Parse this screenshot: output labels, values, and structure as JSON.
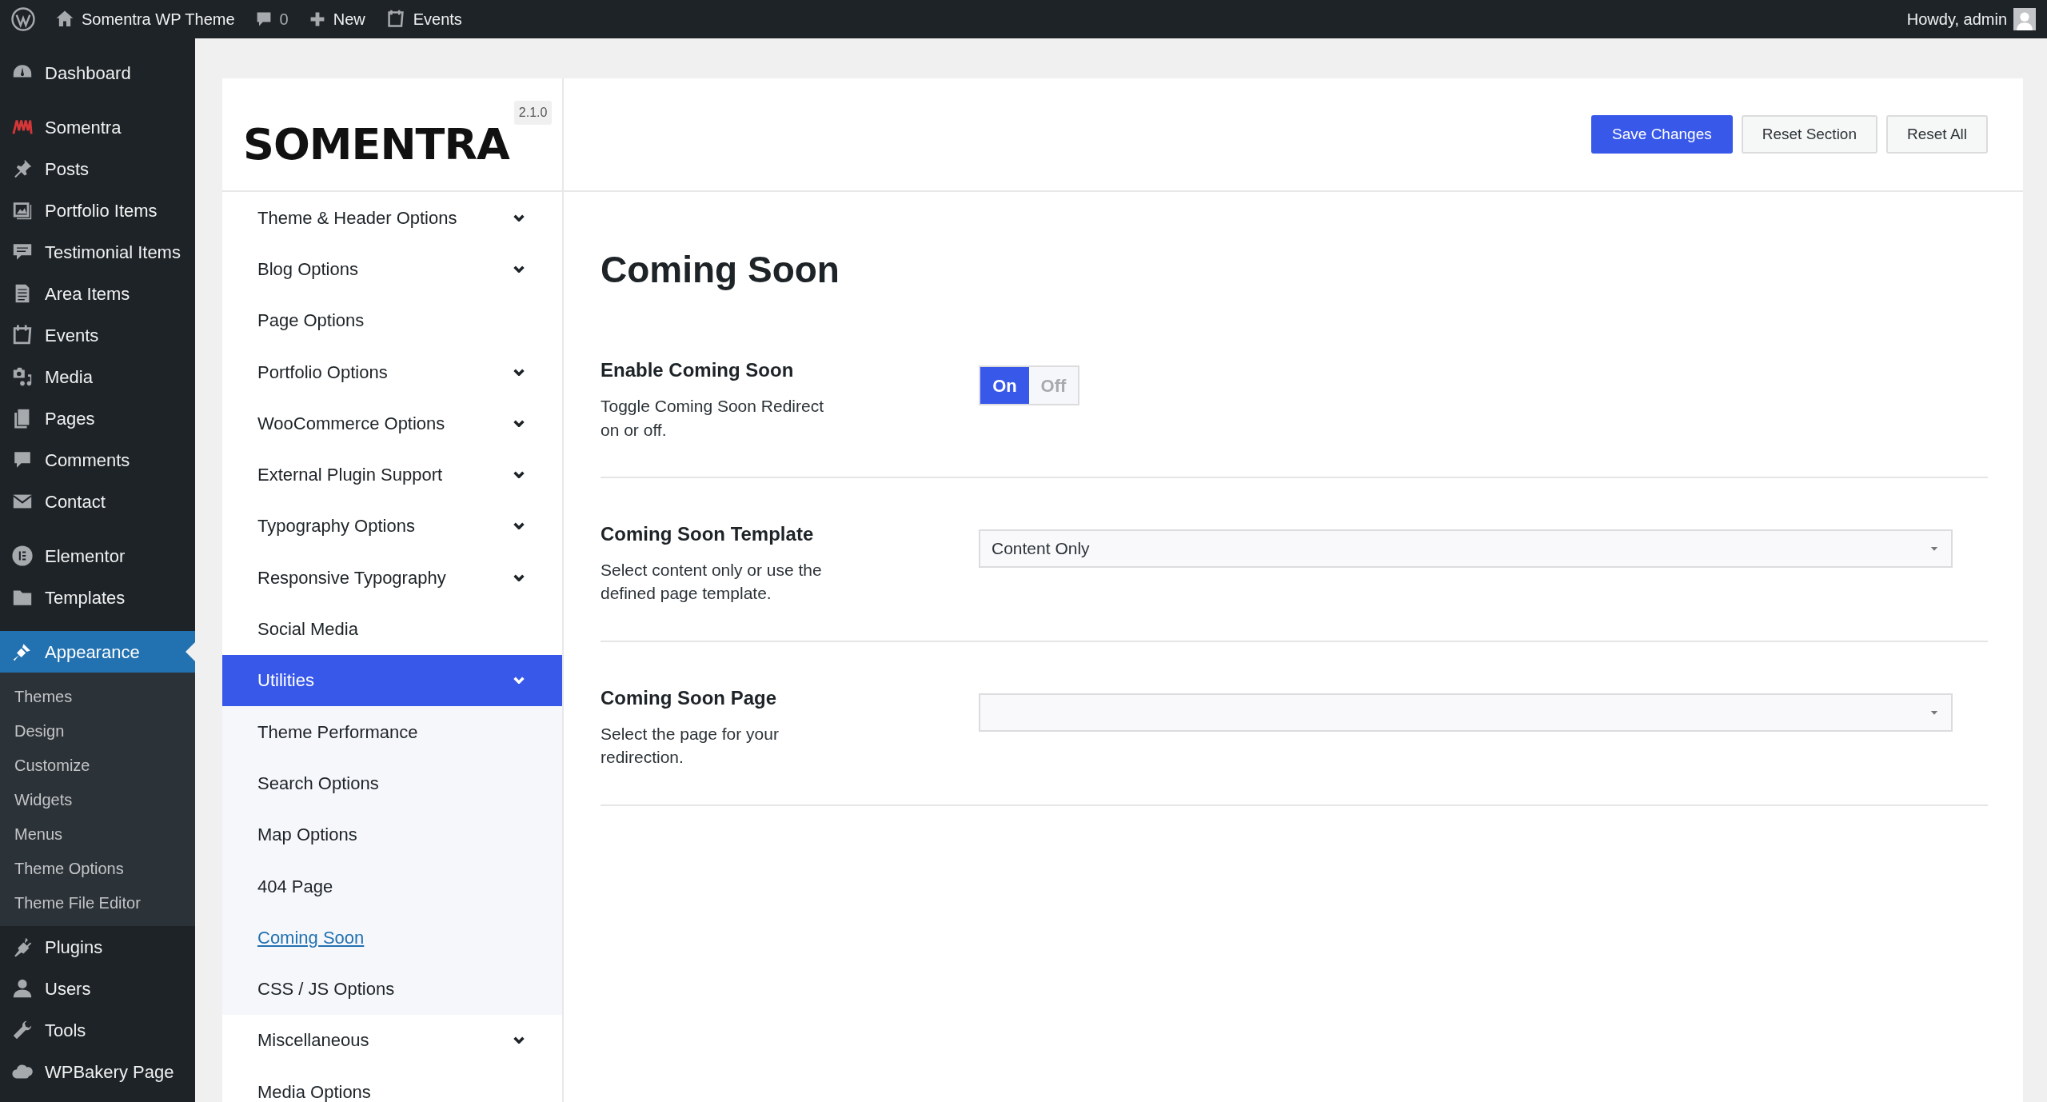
{
  "admin_bar": {
    "site": "Somentra WP Theme",
    "comments": "0",
    "new": "New",
    "events": "Events",
    "account": "Howdy, admin"
  },
  "sidebar": {
    "groups": [
      [
        {
          "label": "Dashboard",
          "selected": false
        }
      ],
      [
        {
          "label": "Somentra",
          "selected": false
        },
        {
          "label": "Posts",
          "selected": false
        },
        {
          "label": "Portfolio Items",
          "selected": false
        },
        {
          "label": "Testimonial Items",
          "selected": false
        },
        {
          "label": "Area Items",
          "selected": false
        },
        {
          "label": "Events",
          "selected": false
        },
        {
          "label": "Media",
          "selected": false
        },
        {
          "label": "Pages",
          "selected": false
        },
        {
          "label": "Comments",
          "selected": false
        },
        {
          "label": "Contact",
          "selected": false
        }
      ],
      [
        {
          "label": "Elementor",
          "selected": false
        },
        {
          "label": "Templates",
          "selected": false
        }
      ],
      [
        {
          "label": "Appearance",
          "selected": true,
          "children": [
            {
              "label": "Themes"
            },
            {
              "label": "Design"
            },
            {
              "label": "Customize"
            },
            {
              "label": "Widgets"
            },
            {
              "label": "Menus"
            },
            {
              "label": "Theme Options"
            },
            {
              "label": "Theme File Editor"
            }
          ]
        },
        {
          "label": "Plugins",
          "selected": false
        },
        {
          "label": "Users",
          "selected": false
        },
        {
          "label": "Tools",
          "selected": false
        },
        {
          "label": "WPBakery Page",
          "selected": false
        }
      ]
    ]
  },
  "options_panel": {
    "logo": "SOMENTRA",
    "version": "2.1.0",
    "nav": [
      {
        "label": "Theme & Header Options",
        "kind": "group",
        "selected": false
      },
      {
        "label": "Blog Options",
        "kind": "group",
        "selected": false
      },
      {
        "label": "Page Options",
        "kind": "page",
        "selected": false
      },
      {
        "label": "Portfolio Options",
        "kind": "group",
        "selected": false
      },
      {
        "label": "WooCommerce Options",
        "kind": "group",
        "selected": false
      },
      {
        "label": "External Plugin Support",
        "kind": "group",
        "selected": false
      },
      {
        "label": "Typography Options",
        "kind": "group",
        "selected": false
      },
      {
        "label": "Responsive Typography",
        "kind": "group",
        "selected": false
      },
      {
        "label": "Social Media",
        "kind": "page",
        "selected": false
      },
      {
        "label": "Utilities",
        "kind": "group",
        "selected": true,
        "children": [
          {
            "label": "Theme Performance",
            "selected": false
          },
          {
            "label": "Search Options",
            "selected": false
          },
          {
            "label": "Map Options",
            "selected": false
          },
          {
            "label": "404 Page",
            "selected": false
          },
          {
            "label": "Coming Soon",
            "selected": true
          },
          {
            "label": "CSS / JS Options",
            "selected": false
          }
        ]
      },
      {
        "label": "Miscellaneous",
        "kind": "group",
        "selected": false
      },
      {
        "label": "Media Options",
        "kind": "page",
        "selected": false
      }
    ],
    "buttons": [
      {
        "label": "Save Changes",
        "kind": "primary"
      },
      {
        "label": "Reset Section",
        "kind": "secondary"
      },
      {
        "label": "Reset All",
        "kind": "secondary"
      }
    ],
    "section_title": "Coming Soon",
    "fields": [
      {
        "kind": "toggle",
        "title": "Enable Coming Soon",
        "description": "Toggle Coming Soon Redirect on or off.",
        "options": [
          {
            "label": "On",
            "selected": true
          },
          {
            "label": "Off",
            "selected": false
          }
        ]
      },
      {
        "kind": "select",
        "title": "Coming Soon Template",
        "description": "Select content only or use the defined page template.",
        "value": "Content Only"
      },
      {
        "kind": "select",
        "title": "Coming Soon Page",
        "description": "Select the page for your redirection."
      }
    ]
  }
}
